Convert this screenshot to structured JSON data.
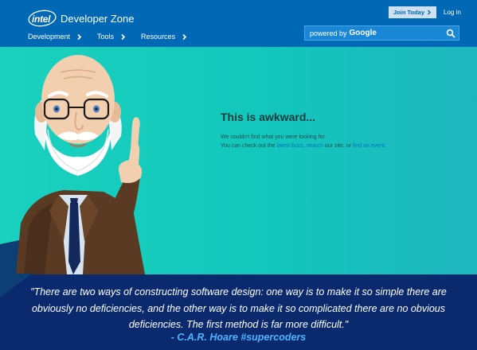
{
  "brand": {
    "logo_text": "intel",
    "zone": "Developer Zone"
  },
  "nav": [
    {
      "label": "Development"
    },
    {
      "label": "Tools"
    },
    {
      "label": "Resources"
    }
  ],
  "header": {
    "join_label": "Join Today",
    "login_label": "Log in"
  },
  "search": {
    "powered_by": "powered by",
    "provider": "Google"
  },
  "error": {
    "title": "This is awkward...",
    "line1": "We couldn't find what you were looking for.",
    "line2_prefix": "You can check out the ",
    "link_latest": "latest buzz",
    "comma": ", ",
    "link_search": "search",
    "line2_mid": " our site, or ",
    "link_event": "find an event",
    "period": "."
  },
  "quote": {
    "text": "\"There are two ways of constructing software design: one way is to make it so simple there are obviously no deficiencies, and the other way is to make it so complicated there are no obvious deficiencies. The first method is far more difficult.\"",
    "attribution": "- C.A.R. Hoare #supercoders"
  },
  "colors": {
    "header_bg": "#0068b5",
    "hero_bg": "#1ad1be",
    "quote_bg": "#0b2a6e",
    "link": "#0071c5",
    "attribution": "#4fb4ff"
  }
}
